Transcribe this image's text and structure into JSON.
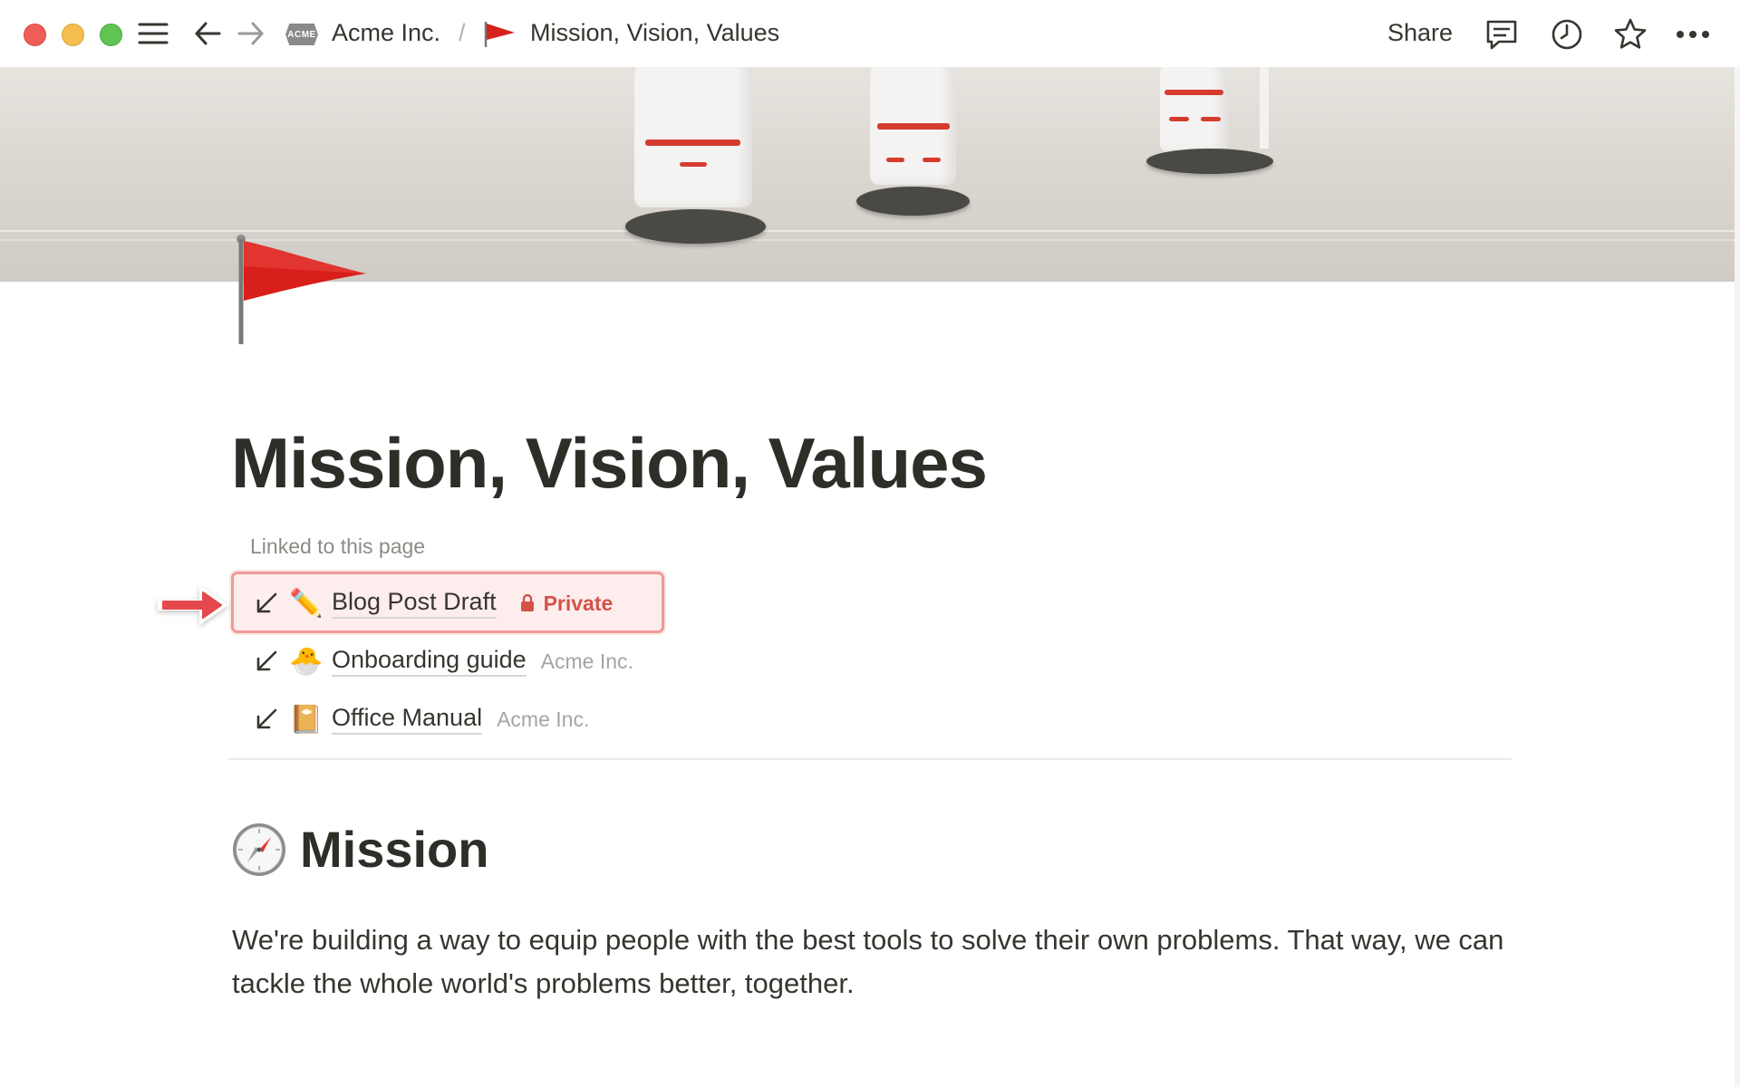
{
  "topbar": {
    "workspace_logo": "ACME",
    "workspace": "Acme Inc.",
    "separator": "/",
    "page_title": "Mission, Vision, Values",
    "share_label": "Share",
    "icons": [
      "menu-icon",
      "back-arrow-icon",
      "forward-arrow-icon",
      "comment-icon",
      "clock-icon",
      "star-icon",
      "more-icon"
    ]
  },
  "page": {
    "icon": "red-flag-icon",
    "title": "Mission, Vision, Values",
    "linked_label": "Linked to this page",
    "backlinks": [
      {
        "emoji": "✏️",
        "title": "Blog Post Draft",
        "meta": "Private",
        "private": true
      },
      {
        "emoji": "🐣",
        "title": "Onboarding guide",
        "meta": "Acme Inc.",
        "private": false
      },
      {
        "emoji": "📔",
        "title": "Office Manual",
        "meta": "Acme Inc.",
        "private": false
      }
    ],
    "mission": {
      "heading": "Mission",
      "icon": "compass-icon",
      "text": "We're building a way to equip people with the best tools to solve their own problems. That way, we can tackle the whole world's problems better, together."
    }
  },
  "colors": {
    "highlight_border": "#ef9a96",
    "highlight_fill": "#fdeeed",
    "private_text": "#d4524a",
    "annotation_arrow": "#e5484d"
  }
}
